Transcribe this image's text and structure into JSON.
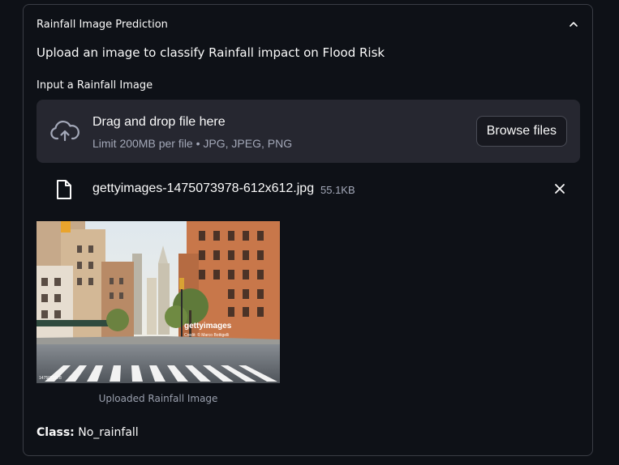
{
  "expander": {
    "title": "Rainfall Image Prediction",
    "toggle_icon": "chevron-up-icon"
  },
  "description": "Upload an image to classify Rainfall impact on Flood Risk",
  "uploader": {
    "label": "Input a Rainfall Image",
    "dropzone_text": "Drag and drop file here",
    "limit_text": "Limit 200MB per file • JPG, JPEG, PNG",
    "browse_label": "Browse files",
    "upload_icon": "cloud-upload-icon"
  },
  "file": {
    "name": "gettyimages-1475073978-612x612.jpg",
    "size": "55.1KB",
    "icon": "file-icon",
    "remove_icon": "close-icon"
  },
  "image": {
    "caption": "Uploaded Rainfall Image",
    "watermark": "gettyimages",
    "credit": "Credit: © Marco Bottigelli",
    "id_text": "1475073978"
  },
  "result": {
    "label": "Class:",
    "value": "No_rainfall"
  },
  "colors": {
    "background": "#0e1117",
    "panel": "#262730",
    "border": "#3a3d45",
    "text": "#fafafa",
    "muted": "#a3a8b8"
  }
}
